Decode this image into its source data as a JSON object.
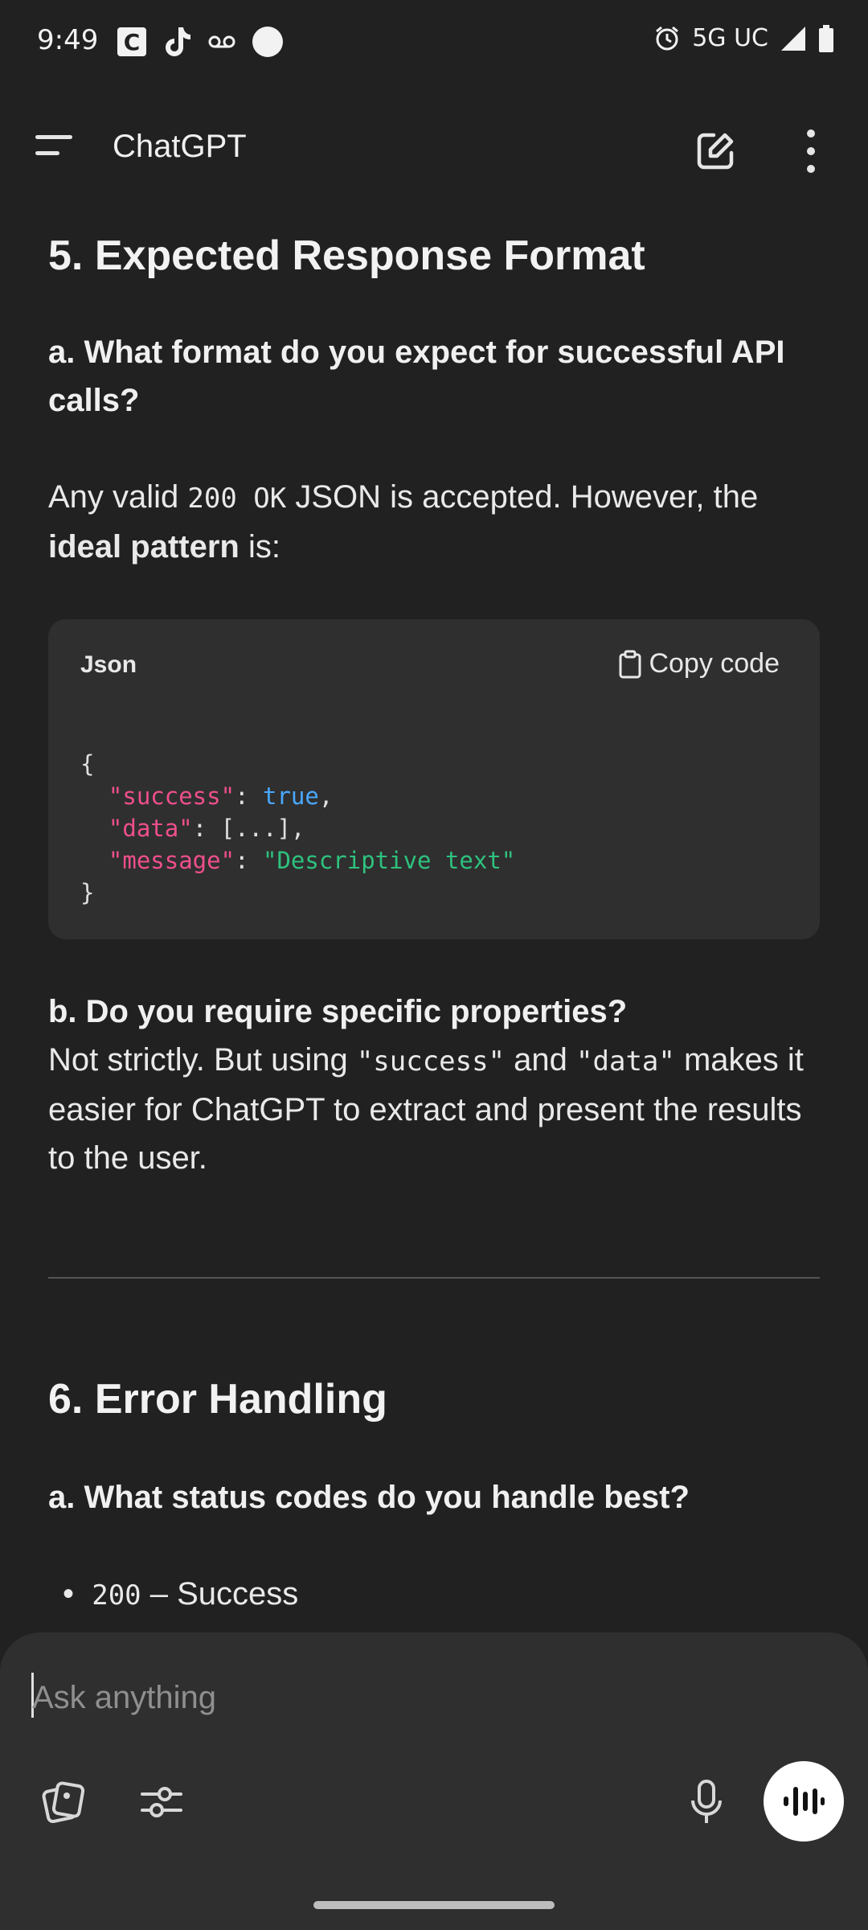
{
  "status_bar": {
    "time": "9:49",
    "network": "5G UC"
  },
  "header": {
    "title": "ChatGPT"
  },
  "content": {
    "section5_title": "5. Expected Response Format",
    "q5a": "a. What format do you expect for successful API calls?",
    "p1_before": "Any valid ",
    "p1_code": "200 OK",
    "p1_after": " JSON is accepted. However, the ",
    "p1_bold": "ideal pattern",
    "p1_end": " is:",
    "code": {
      "language": "Json",
      "copy_label": "Copy code",
      "open": "{",
      "key_success": "\"success\"",
      "val_success": "true",
      "key_data": "\"data\"",
      "val_data": "[...]",
      "key_message": "\"message\"",
      "val_message": "\"Descriptive text\"",
      "close": "}"
    },
    "q5b": "b. Do you require specific properties?",
    "p2_before": "Not strictly. But using ",
    "p2_code1": "\"success\"",
    "p2_mid": " and ",
    "p2_code2": "\"data\"",
    "p2_after": " makes it easier for ChatGPT to extract and present the results to the user.",
    "section6_title": "6. Error Handling",
    "q6a": "a. What status codes do you handle best?",
    "bullet1_code": "200",
    "bullet1_text": " – Success"
  },
  "composer": {
    "placeholder": "Ask anything"
  }
}
